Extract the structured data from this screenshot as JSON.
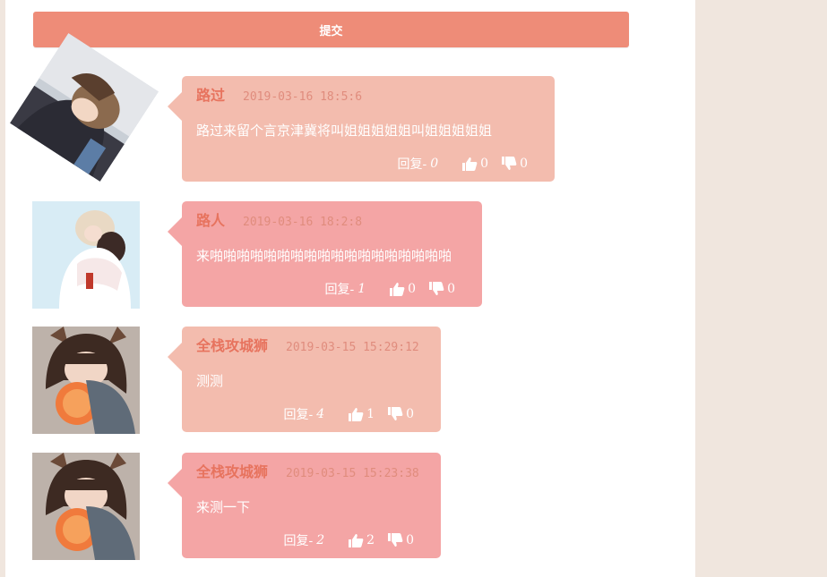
{
  "submit_label": "提交",
  "theme": {
    "bubble_light": "#f3bcae",
    "bubble_pink": "#f4a5a5",
    "accent": "#ee8c78"
  },
  "comments": [
    {
      "author": "路过",
      "time": "2019-03-16 18:5:6",
      "content": "路过来留个言京津冀将叫姐姐姐姐姐叫姐姐姐姐姐",
      "reply_label": "回复-",
      "reply_count": "0",
      "likes": "0",
      "dislikes": "0",
      "like_icon": "thumbs-up-icon",
      "dislike_icon": "thumbs-down-icon"
    },
    {
      "author": "路人",
      "time": "2019-03-16 18:2:8",
      "content": "来啪啪啪啪啪啪啪啪啪啪啪啪啪啪啪啪啪啪",
      "reply_label": "回复-",
      "reply_count": "1",
      "likes": "0",
      "dislikes": "0",
      "like_icon": "thumbs-up-icon",
      "dislike_icon": "thumbs-down-icon"
    },
    {
      "author": "全栈攻城狮",
      "time": "2019-03-15 15:29:12",
      "content": "测测",
      "reply_label": "回复-",
      "reply_count": "4",
      "likes": "1",
      "dislikes": "0",
      "like_icon": "thumbs-up-icon",
      "dislike_icon": "thumbs-down-icon"
    },
    {
      "author": "全栈攻城狮",
      "time": "2019-03-15 15:23:38",
      "content": "来测一下",
      "reply_label": "回复-",
      "reply_count": "2",
      "likes": "2",
      "dislikes": "0",
      "like_icon": "thumbs-up-icon",
      "dislike_icon": "thumbs-down-icon"
    }
  ]
}
